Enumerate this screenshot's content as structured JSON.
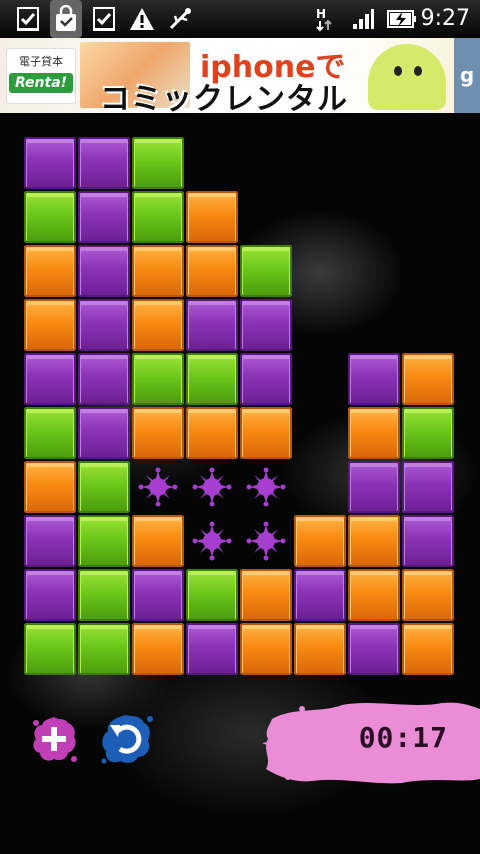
{
  "status_bar": {
    "time": "9:27",
    "icons": [
      "download-done-icon",
      "download-done-icon",
      "bag-icon",
      "download-done-icon",
      "warning-icon",
      "usb-icon",
      "data-arrows-icon",
      "signal-icon",
      "battery-charging-icon"
    ]
  },
  "ad": {
    "brand_jp": "電子貸本",
    "brand_name": "Renta!",
    "line1": "iphoneで",
    "line2": "コミックレンタル",
    "corner": "g"
  },
  "board": {
    "columns": 8,
    "rows": 10,
    "tiles": [
      "P P G . . . . .",
      "G P G O . . . .",
      "O P O O G . . .",
      "O P O P P . . .",
      "P P G G P . P O",
      "G P O O O . O G",
      "O G s s s . P P",
      "P G O s s O O P",
      "P G P G O P O O",
      "G G O P O O P O"
    ],
    "colors": {
      "P": "#8b33b8",
      "G": "#6cc81a",
      "O": "#f88a12",
      "splat": "#a63fd0"
    }
  },
  "controls": {
    "add_icon": "plus-splat-icon",
    "undo_icon": "undo-icon",
    "timer": "00:17"
  }
}
